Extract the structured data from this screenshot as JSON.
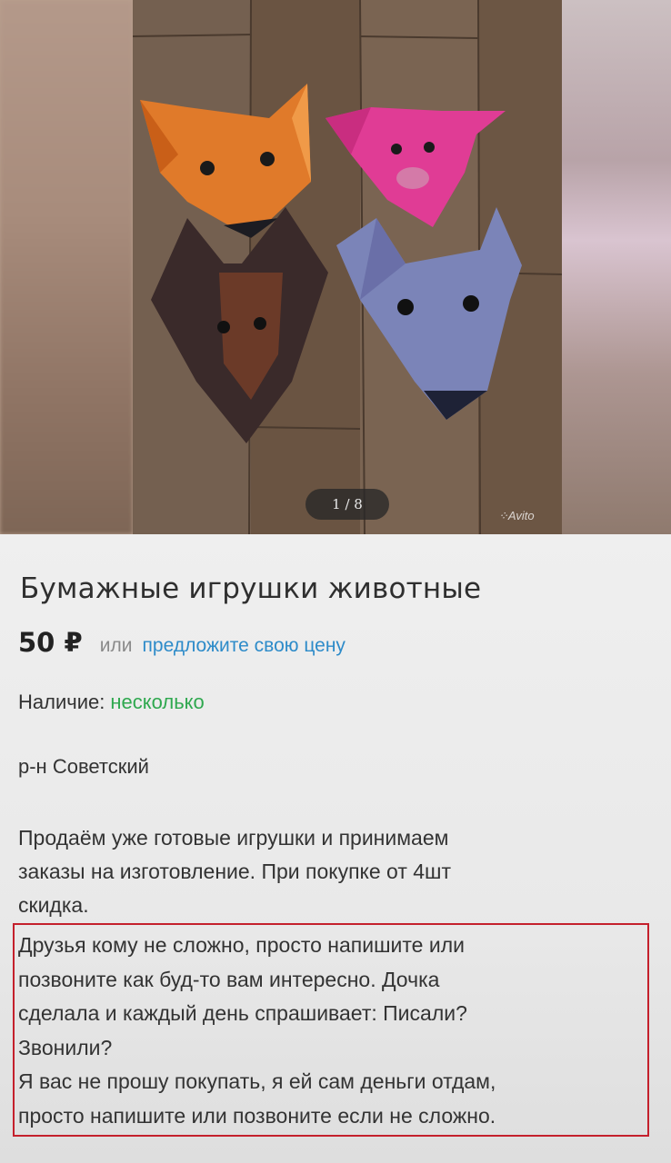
{
  "gallery": {
    "counter": "1 / 8",
    "watermark": "Avito",
    "photo_subject": "four paper origami animal faces on a wooden floor"
  },
  "listing": {
    "title": "Бумажные игрушки животные",
    "price": "50 ₽",
    "price_or": "или",
    "offer_link": "предложите свою цену",
    "availability_label": "Наличие:",
    "availability_value": "несколько",
    "district": "р-н Советский",
    "description_lines": [
      "Продаём уже готовые игрушки и принимаем",
      "заказы на изготовление. При покупке от 4шт",
      "скидка."
    ],
    "highlighted_lines": [
      "Друзья кому не сложно, просто напишите или",
      "позвоните как буд-то вам интересно. Дочка",
      "сделала и каждый день спрашивает: Писали?",
      "Звонили?",
      "Я вас не прошу покупать, я ей сам деньги отдам,",
      "просто напишите или позвоните если не сложно."
    ]
  },
  "colors": {
    "accent_link": "#2d8bc9",
    "availability_green": "#2fa84f",
    "highlight_border": "#c4202c"
  }
}
